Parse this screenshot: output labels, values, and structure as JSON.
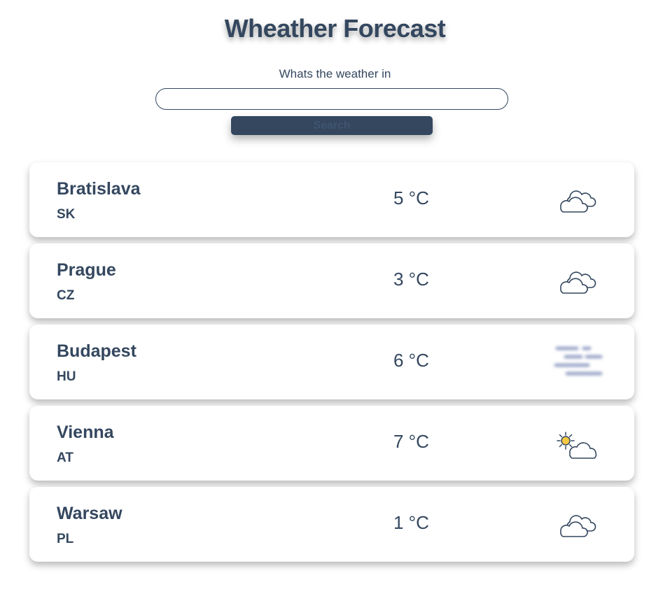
{
  "header": {
    "title": "Wheather Forecast"
  },
  "search": {
    "label": "Whats the weather in",
    "value": "",
    "placeholder": "",
    "button_label": "Search"
  },
  "cities": [
    {
      "name": "Bratislava",
      "country": "SK",
      "temperature": "5 °C",
      "icon": "cloudy-icon"
    },
    {
      "name": "Prague",
      "country": "CZ",
      "temperature": "3 °C",
      "icon": "cloudy-icon"
    },
    {
      "name": "Budapest",
      "country": "HU",
      "temperature": "6 °C",
      "icon": "fog-icon"
    },
    {
      "name": "Vienna",
      "country": "AT",
      "temperature": "7 °C",
      "icon": "partly-sunny-icon"
    },
    {
      "name": "Warsaw",
      "country": "PL",
      "temperature": "1 °C",
      "icon": "cloudy-icon"
    }
  ],
  "colors": {
    "primary": "#34475f",
    "background": "#ffffff",
    "sun": "#f5c842"
  }
}
